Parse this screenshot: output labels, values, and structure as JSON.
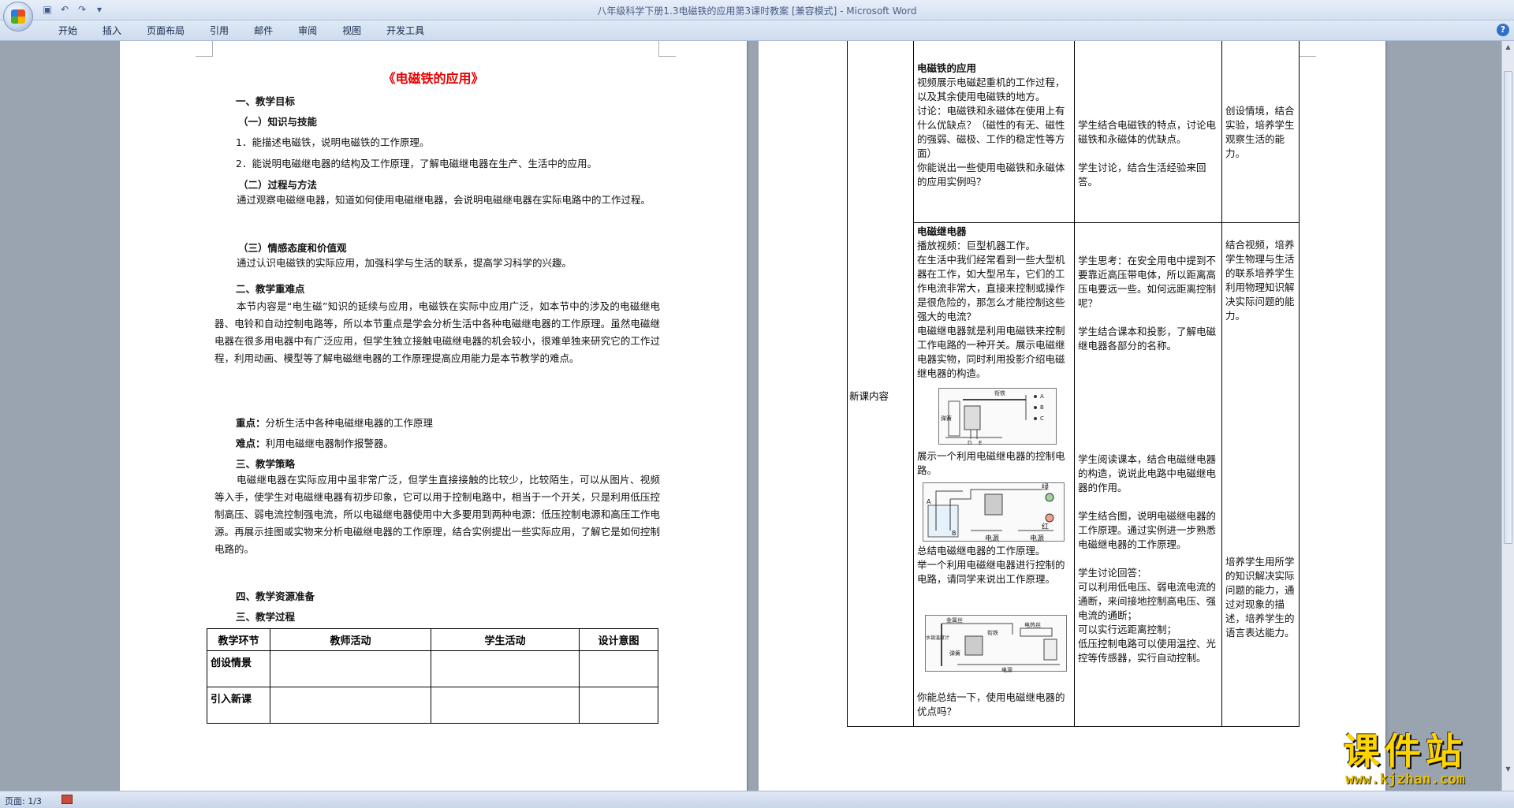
{
  "window": {
    "title": "八年级科学下册1.3电磁铁的应用第3课时教案 [兼容模式] - ",
    "app": "Microsoft Word"
  },
  "ribbon": {
    "tabs": [
      "开始",
      "插入",
      "页面布局",
      "引用",
      "邮件",
      "审阅",
      "视图",
      "开发工具"
    ]
  },
  "page1": {
    "title": "《电磁铁的应用》",
    "lines": [
      {
        "text": "一、教学目标",
        "bold": true
      },
      {
        "text": "（一）知识与技能",
        "bold": true
      },
      {
        "text": "1．能描述电磁铁，说明电磁铁的工作原理。"
      },
      {
        "text": "2．能说明电磁继电器的结构及工作原理，了解电磁继电器在生产、生活中的应用。"
      },
      {
        "text": "（二）过程与方法",
        "bold": true
      }
    ],
    "para1": "通过观察电磁继电器，知道如何使用电磁继电器，会说明电磁继电器在实际电路中的工作过程。",
    "h3": "（三）情感态度和价值观",
    "para2": "通过认识电磁铁的实际应用，加强科学与生活的联系，提高学习科学的兴趣。",
    "h_key": "二、教学重难点",
    "para3": "本节内容是“电生磁”知识的延续与应用，电磁铁在实际中应用广泛，如本节中的涉及的电磁继电器、电铃和自动控制电路等，所以本节重点是学会分析生活中各种电磁继电器的工作原理。虽然电磁继电器在很多用电器中有广泛应用，但学生独立接触电磁继电器的机会较小，很难单独来研究它的工作过程，利用动画、模型等了解电磁继电器的工作原理提高应用能力是本节教学的难点。",
    "key_label": "重点：",
    "key_text": "分析生活中各种电磁继电器的工作原理",
    "diff_label": "难点：",
    "diff_text": "利用电磁继电器制作报警器。",
    "h_strategy": "三、教学策略",
    "para4": "电磁继电器在实际应用中虽非常广泛，但学生直接接触的比较少，比较陌生，可以从图片、视频等入手，使学生对电磁继电器有初步印象，它可以用于控制电路中，相当于一个开关，只是利用低压控制高压、弱电流控制强电流，所以电磁继电器使用中大多要用到两种电源：低压控制电源和高压工作电源。再展示挂图或实物来分析电磁继电器的工作原理，结合实例提出一些实际应用，了解它是如何控制电路的。",
    "h_res": "四、教学资源准备",
    "h_proc": "三、教学过程",
    "table": {
      "headers": [
        "教学环节",
        "教师活动",
        "学生活动",
        "设计意图"
      ],
      "rows": [
        "创设情景",
        "引入新课"
      ]
    }
  },
  "page2": {
    "section_label": "新课内容",
    "block1_head": "电磁铁的应用",
    "block1_teacher": "视频展示电磁起重机的工作过程，以及其余使用电磁铁的地方。\n讨论：电磁铁和永磁体在使用上有什么优缺点？（磁性的有无、磁性的强弱、磁极、工作的稳定性等方面）\n你能说出一些使用电磁铁和永磁体的应用实例吗？",
    "block1_student": "学生结合电磁铁的特点，讨论电磁铁和永磁体的优缺点。\n\n学生讨论，结合生活经验来回答。",
    "block1_intent": "创设情境，结合实验，培养学生观察生活的能力。",
    "block2_head": "电磁继电器",
    "block2_teacher_a": "播放视频：巨型机器工作。\n在生活中我们经常看到一些大型机器在工作，如大型吊车，它们的工作电流非常大，直接来控制或操作是很危险的，那怎么才能控制这些强大的电流？\n电磁继电器就是利用电磁铁来控制工作电路的一种开关。展示电磁继电器实物，同时利用投影介绍电磁继电器的构造。",
    "block2_teacher_b": "展示一个利用电磁继电器的控制电路。",
    "block2_teacher_c": "总结电磁继电器的工作原理。\n举一个利用电磁继电器进行控制的电路，请同学来说出工作原理。",
    "block2_teacher_d": "你能总结一下，使用电磁继电器的优点吗？",
    "block2_student_a": "学生思考：在安全用电中提到不要靠近高压带电体，所以距离高压电要远一些。如何远距离控制呢？\n\n学生结合课本和投影，了解电磁继电器各部分的名称。",
    "block2_student_b": "学生阅读课本，结合电磁继电器的构造，说说此电路中电磁继电器的作用。\n\n学生结合图，说明电磁继电器的工作原理。通过实例进一步熟悉电磁继电器的工作原理。\n\n学生讨论回答：\n可以利用低电压、弱电流电流的通断，来间接地控制高电压、强电流的通断；\n可以实行远距离控制；\n低压控制电路可以使用温控、光控等传感器，实行自动控制。",
    "block2_intent_a": "结合视频，培养学生物理与生活的联系培养学生利用物理知识解决实际问题的能力。",
    "block2_intent_b": "培养学生用所学的知识解决实际问题的能力，通过对现象的描述，培养学生的语言表达能力。",
    "fig1_labels": [
      "衔铁",
      "弹簧",
      "A",
      "B",
      "C",
      "D",
      "E"
    ],
    "fig2_labels": [
      "A",
      "B",
      "绿",
      "红",
      "电源",
      "电源"
    ],
    "fig3_labels": [
      "金属丝",
      "水银温度计",
      "衔铁",
      "弹簧",
      "电热丝",
      "电源"
    ]
  },
  "status": {
    "page": "页面: 1/3"
  },
  "watermark": {
    "text": "课件站",
    "url": "www.kjzhan.com"
  },
  "colors": {
    "title_red": "#e60000",
    "watermark_yellow": "#ffd400",
    "workspace": "#9aa3b0"
  }
}
